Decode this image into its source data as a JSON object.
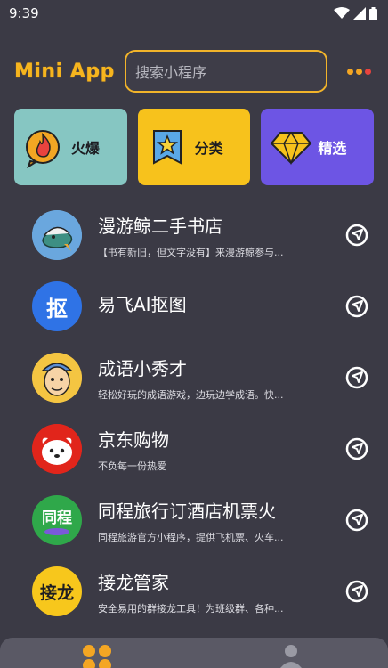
{
  "status": {
    "time": "9:39"
  },
  "header": {
    "logo": "Mini App",
    "search_placeholder": "搜索小程序"
  },
  "categories": [
    {
      "label": "火爆",
      "icon": "flame-icon"
    },
    {
      "label": "分类",
      "icon": "bookmark-star-icon"
    },
    {
      "label": "精选",
      "icon": "diamond-icon"
    }
  ],
  "apps": [
    {
      "title": "漫游鲸二手书店",
      "desc": "【书有新旧，但文字没有】来漫游鲸参与..."
    },
    {
      "title": "易飞AI抠图",
      "desc": ""
    },
    {
      "title": "成语小秀才",
      "desc": "轻松好玩的成语游戏，边玩边学成语。快..."
    },
    {
      "title": "京东购物",
      "desc": "不负每一份热爱"
    },
    {
      "title": "同程旅行订酒店机票火",
      "desc": "同程旅游官方小程序，提供飞机票、火车..."
    },
    {
      "title": "接龙管家",
      "desc": "安全易用的群接龙工具！为班级群、各种..."
    }
  ],
  "avatar_text": {
    "yifei": "抠",
    "tongcheng": "同程",
    "jielong": "接龙"
  },
  "tabs": [
    {
      "icon": "grid-apps-icon"
    },
    {
      "icon": "user-icon"
    }
  ]
}
